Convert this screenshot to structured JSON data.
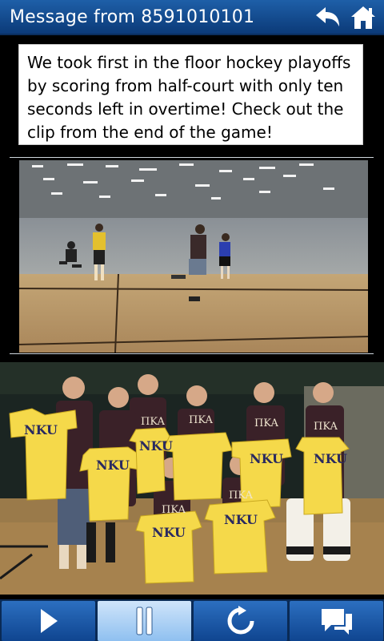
{
  "header": {
    "title": "Message from 8591010101"
  },
  "icons": {
    "back": "back-arrow-icon",
    "home": "home-icon",
    "play": "play-icon",
    "pause": "pause-icon",
    "replay": "refresh-icon",
    "reply": "chat-bubbles-icon"
  },
  "message": {
    "body": "We took first in the floor hockey playoffs by scoring from half-court with only ten seconds left in overtime!  Check out the clip from the end of the game!"
  },
  "photo": {
    "shirt_text": "NKU",
    "jersey_text": "ΠKA"
  },
  "toolbar": {
    "active": "pause"
  },
  "colors": {
    "header_blue": "#1e5fa8",
    "toolbar_blue": "#0f4590",
    "active_button": "#bfe0fb",
    "shirt_yellow": "#f5d94a",
    "jersey_maroon": "#3a2128"
  }
}
